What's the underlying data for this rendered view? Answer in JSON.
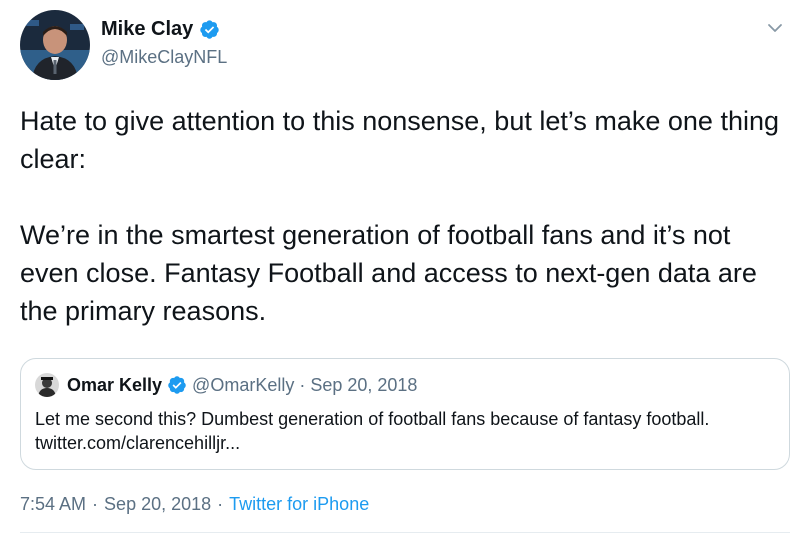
{
  "author": {
    "name": "Mike Clay",
    "handle": "@MikeClayNFL",
    "verified": true
  },
  "tweet": {
    "paragraphs": [
      "Hate to give attention to this nonsense, but let’s make one thing clear:",
      "We’re in the smartest generation of football fans and it’s not even close. Fantasy Football and access to next-gen data are the primary reasons."
    ]
  },
  "quoted_tweet": {
    "name": "Omar Kelly",
    "handle": "@OmarKelly",
    "separator": "·",
    "date": "Sep 20, 2018",
    "verified": true,
    "text": "Let me second this? Dumbest generation of football fans because of fantasy football. twitter.com/clarencehilljr..."
  },
  "meta": {
    "time": "7:54 AM",
    "separator": "·",
    "date": "Sep 20, 2018",
    "source": "Twitter for iPhone"
  },
  "icons": {
    "verified": "verified-badge-icon",
    "menu": "chevron-down-icon"
  },
  "colors": {
    "accent": "#1d9bf0",
    "text": "#0f1419",
    "secondary": "#5b7083",
    "border": "#cfd9de"
  }
}
